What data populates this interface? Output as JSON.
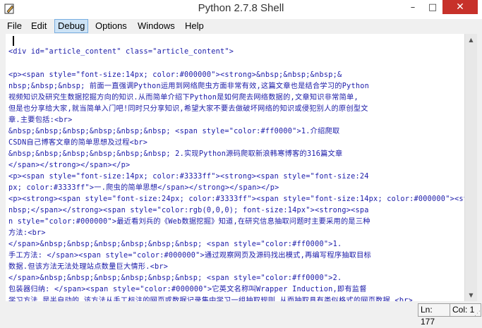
{
  "window": {
    "title": "Python 2.7.8 Shell",
    "controls": [
      "–",
      "□",
      "✕"
    ]
  },
  "menubar": {
    "items": [
      "File",
      "Edit",
      "Debug",
      "Options",
      "Windows",
      "Help"
    ],
    "active": "Debug"
  },
  "editor": {
    "lines": [
      "<div id=\"article_content\" class=\"article_content\">",
      "",
      "<p><span style=\"font-size:14px; color:#000000\"><strong>&nbsp;&nbsp;&nbsp;&",
      "nbsp;&nbsp;&nbsp; 前面一直强调Python运用到网络爬虫方面非常有效,这篇文章也是结合学习的Python",
      "视频知识及研究生数据挖掘方向的知识.从而简单介绍下Python是如何爬去网络数据的,文章知识非常简单,",
      "但是也分享给大家,就当简单入门吧!同时只分享知识,希望大家不要去做破坏网络的知识或侵犯别人的原创型文",
      "章.主要包括:<br>",
      "&nbsp;&nbsp;&nbsp;&nbsp;&nbsp;&nbsp; <span style=\"color:#ff0000\">1.介绍爬取",
      "CSDN自己博客文章的简单思想及过程<br>",
      "&nbsp;&nbsp;&nbsp;&nbsp;&nbsp;&nbsp; 2.实现Python源码爬取新浪韩寒博客的316篇文章",
      "</span></strong></span></p>",
      "<p><span style=\"font-size:14px; color:#3333ff\"><strong><span style=\"font-size:24",
      "px; color:#3333ff\">一.爬虫的简单思想</span></strong></span></p>",
      "<p><strong><span style=\"font-size:24px; color:#3333ff\"><span style=\"font-size:14px; color:#000000\"><strong>&nbsp;&nbsp;&nbsp;&",
      "nbsp;</span></strong><span style=\"color:rgb(0,0,0); font-size:14px\"><strong><spa",
      "n style=\"color:#000000\">最近看刘兵的《Web数据挖掘》知道,在研究信息抽取问题时主要采用的是三种",
      "方法:<br>",
      "</span>&nbsp;&nbsp;&nbsp;&nbsp;&nbsp;&nbsp; <span style=\"color:#ff0000\">1.",
      "手工方法: </span><span style=\"color:#000000\">通过观察网页及源码找出模式,再编写程序抽取目标",
      "数据.但该方法无法处理站点数量巨大情形.<br>",
      "</span>&nbsp;&nbsp;&nbsp;&nbsp;&nbsp;&nbsp; <span style=\"color:#ff0000\">2.",
      "包装器归纳: </span><span style=\"color:#000000\">它英文名称叫Wrapper Induction,即有监督",
      "学习方法,是半自动的.该方法从手工标注的网页或数据记录集中学习一组抽取规则,从而抽取具有类似格式的网页数据.<br>"
    ]
  },
  "status": {
    "line": "Ln: 177",
    "col": "Col: 1"
  }
}
